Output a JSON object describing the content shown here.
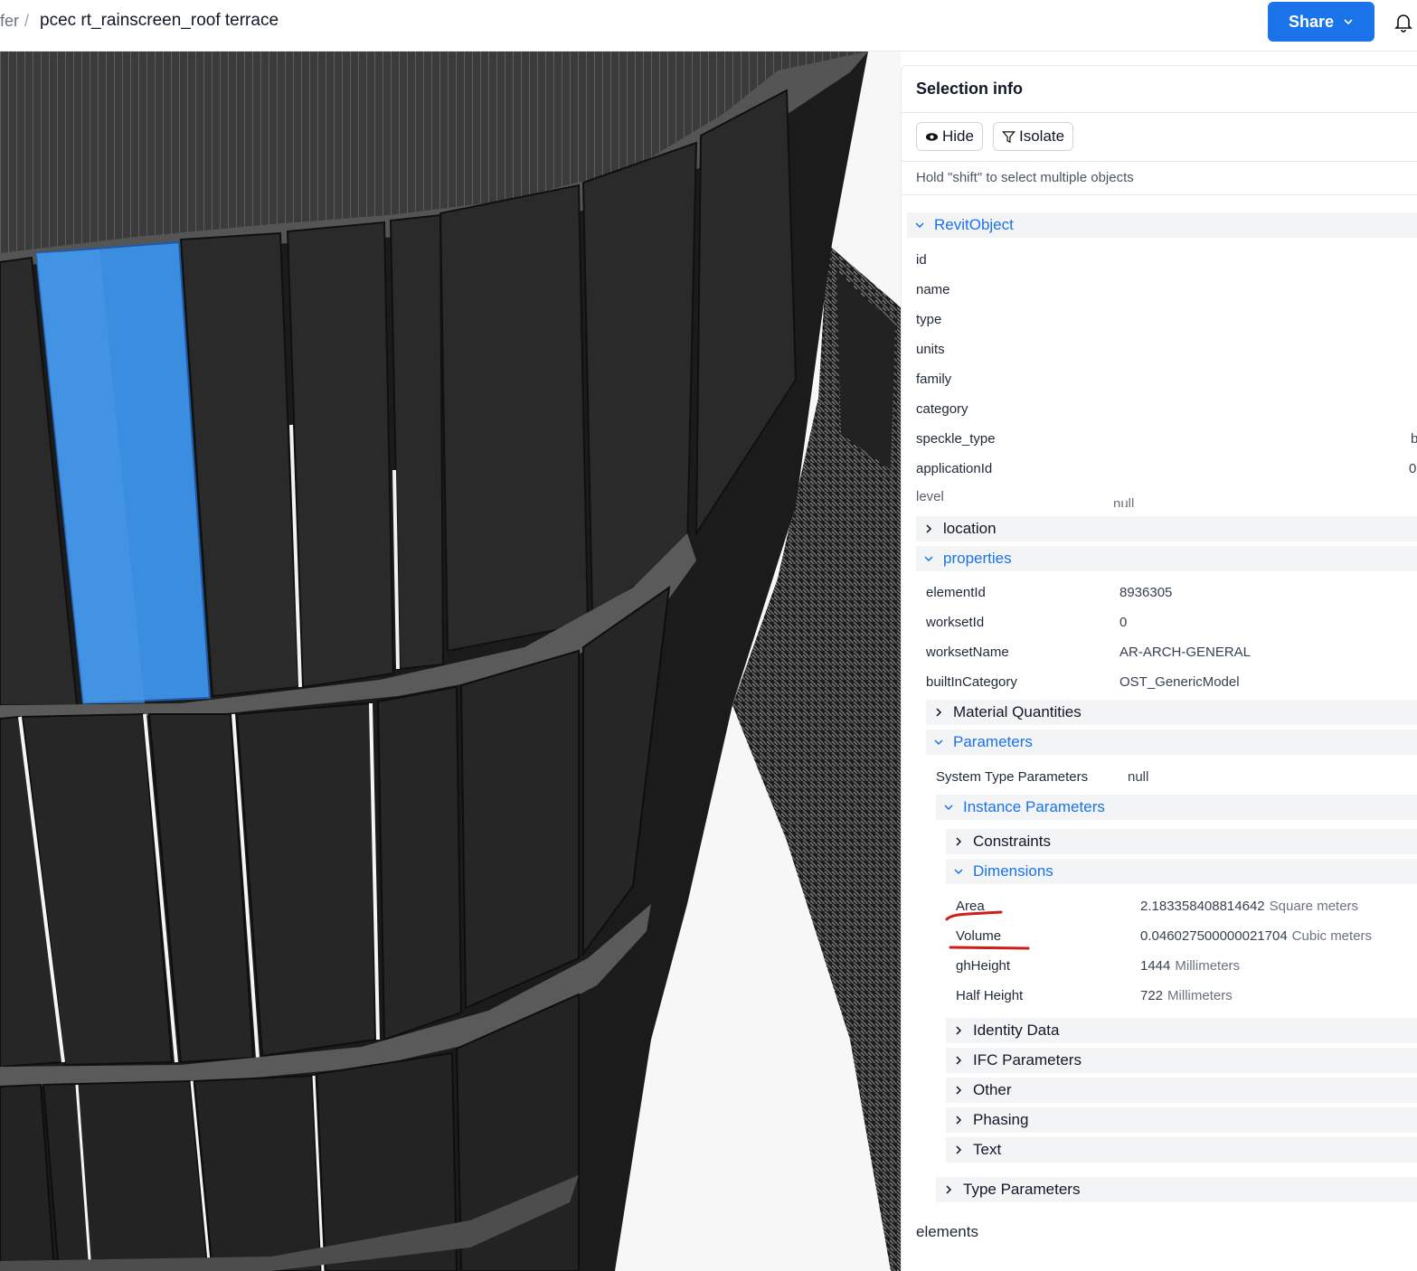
{
  "header": {
    "breadcrumb_prev": "fer",
    "breadcrumb_sep": "/",
    "title": "pcec rt_rainscreen_roof terrace",
    "share_label": "Share"
  },
  "panel": {
    "title": "Selection info",
    "hide_label": "Hide",
    "isolate_label": "Isolate",
    "hint": "Hold \"shift\" to select multiple objects",
    "root_label": "RevitObject",
    "root_fields": [
      {
        "key": "id",
        "value": ""
      },
      {
        "key": "name",
        "value": ""
      },
      {
        "key": "type",
        "value": ""
      },
      {
        "key": "units",
        "value": ""
      },
      {
        "key": "family",
        "value": ""
      },
      {
        "key": "category",
        "value": ""
      },
      {
        "key": "speckle_type",
        "value": "b"
      },
      {
        "key": "applicationId",
        "value": "0"
      },
      {
        "key": "level",
        "value": "null"
      }
    ],
    "location_label": "location",
    "properties_label": "properties",
    "properties_fields": [
      {
        "key": "elementId",
        "value": "8936305"
      },
      {
        "key": "worksetId",
        "value": "0"
      },
      {
        "key": "worksetName",
        "value": "AR-ARCH-GENERAL"
      },
      {
        "key": "builtInCategory",
        "value": "OST_GenericModel"
      }
    ],
    "material_quantities_label": "Material Quantities",
    "parameters_label": "Parameters",
    "system_type_parameters": {
      "key": "System Type Parameters",
      "value": "null"
    },
    "instance_parameters_label": "Instance Parameters",
    "constraints_label": "Constraints",
    "dimensions_label": "Dimensions",
    "dimensions": [
      {
        "key": "Area",
        "value": "2.183358408814642",
        "unit": "Square meters"
      },
      {
        "key": "Volume",
        "value": "0.046027500000021704",
        "unit": "Cubic meters"
      },
      {
        "key": "ghHeight",
        "value": "1444",
        "unit": "Millimeters"
      },
      {
        "key": "Half Height",
        "value": "722",
        "unit": "Millimeters"
      }
    ],
    "instance_groups": [
      "Identity Data",
      "IFC Parameters",
      "Other",
      "Phasing",
      "Text"
    ],
    "type_parameters_label": "Type Parameters",
    "elements_label": "elements"
  },
  "colors": {
    "accent": "#1a73e8",
    "selection": "#3b8de0",
    "annotation": "#d11c1c"
  }
}
